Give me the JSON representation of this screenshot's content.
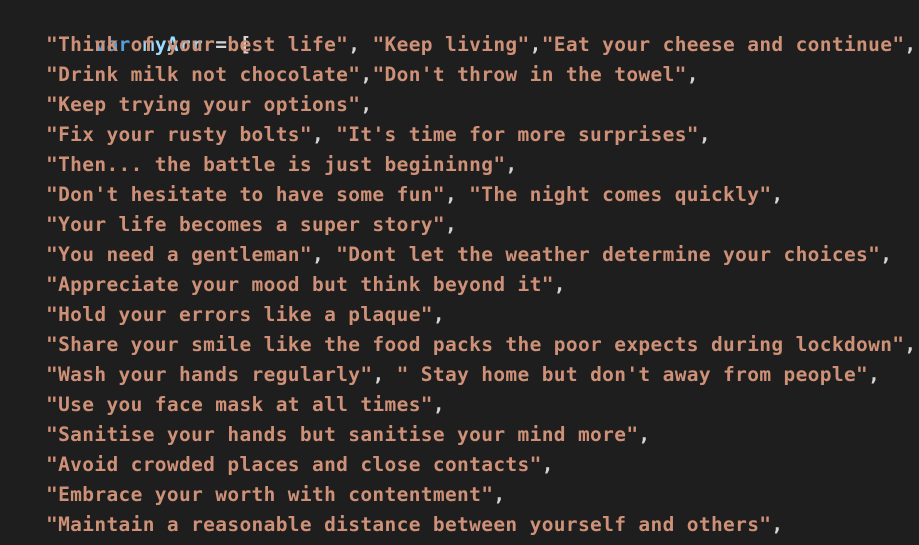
{
  "code": {
    "keyword": "var",
    "identifier": "myArr",
    "operator": "=",
    "open_bracket": "[",
    "lines": [
      [
        {
          "t": "str",
          "v": "\"Think of your best life\""
        },
        {
          "t": "punc",
          "v": ", "
        },
        {
          "t": "str",
          "v": "\"Keep living\""
        },
        {
          "t": "punc",
          "v": ","
        },
        {
          "t": "str",
          "v": "\"Eat your cheese and continue\""
        },
        {
          "t": "punc",
          "v": ","
        }
      ],
      [
        {
          "t": "str",
          "v": "\"Drink milk not chocolate\""
        },
        {
          "t": "punc",
          "v": ","
        },
        {
          "t": "str",
          "v": "\"Don't throw in the towel\""
        },
        {
          "t": "punc",
          "v": ","
        }
      ],
      [
        {
          "t": "str",
          "v": "\"Keep trying your options\""
        },
        {
          "t": "punc",
          "v": ","
        }
      ],
      [
        {
          "t": "str",
          "v": "\"Fix your rusty bolts\""
        },
        {
          "t": "punc",
          "v": ", "
        },
        {
          "t": "str",
          "v": "\"It's time for more surprises\""
        },
        {
          "t": "punc",
          "v": ","
        }
      ],
      [
        {
          "t": "str",
          "v": "\"Then... the battle is just begininng\""
        },
        {
          "t": "punc",
          "v": ","
        }
      ],
      [
        {
          "t": "str",
          "v": "\"Don't hesitate to have some fun\""
        },
        {
          "t": "punc",
          "v": ", "
        },
        {
          "t": "str",
          "v": "\"The night comes quickly\""
        },
        {
          "t": "punc",
          "v": ","
        }
      ],
      [
        {
          "t": "str",
          "v": "\"Your life becomes a super story\""
        },
        {
          "t": "punc",
          "v": ","
        }
      ],
      [
        {
          "t": "str",
          "v": "\"You need a gentleman\""
        },
        {
          "t": "punc",
          "v": ", "
        },
        {
          "t": "str",
          "v": "\"Dont let the weather determine your choices\""
        },
        {
          "t": "punc",
          "v": ","
        }
      ],
      [
        {
          "t": "str",
          "v": "\"Appreciate your mood but think beyond it\""
        },
        {
          "t": "punc",
          "v": ","
        }
      ],
      [
        {
          "t": "str",
          "v": "\"Hold your errors like a plaque\""
        },
        {
          "t": "punc",
          "v": ","
        }
      ],
      [
        {
          "t": "str",
          "v": "\"Share your smile like the food packs the poor expects during lockdown\""
        },
        {
          "t": "punc",
          "v": ","
        }
      ],
      [
        {
          "t": "str",
          "v": "\"Wash your hands regularly\""
        },
        {
          "t": "punc",
          "v": ", "
        },
        {
          "t": "str",
          "v": "\" Stay home but don't away from people\""
        },
        {
          "t": "punc",
          "v": ","
        }
      ],
      [
        {
          "t": "str",
          "v": "\"Use you face mask at all times\""
        },
        {
          "t": "punc",
          "v": ","
        }
      ],
      [
        {
          "t": "str",
          "v": "\"Sanitise your hands but sanitise your mind more\""
        },
        {
          "t": "punc",
          "v": ","
        }
      ],
      [
        {
          "t": "str",
          "v": "\"Avoid crowded places and close contacts\""
        },
        {
          "t": "punc",
          "v": ","
        }
      ],
      [
        {
          "t": "str",
          "v": "\"Embrace your worth with contentment\""
        },
        {
          "t": "punc",
          "v": ","
        }
      ],
      [
        {
          "t": "str",
          "v": "\"Maintain a reasonable distance between yourself and others\""
        },
        {
          "t": "punc",
          "v": ","
        }
      ]
    ]
  },
  "colors": {
    "background": "#1e1e1e",
    "keyword": "#569cd6",
    "identifier": "#9cdcfe",
    "string": "#ce9178",
    "punctuation": "#d4d4d4"
  }
}
